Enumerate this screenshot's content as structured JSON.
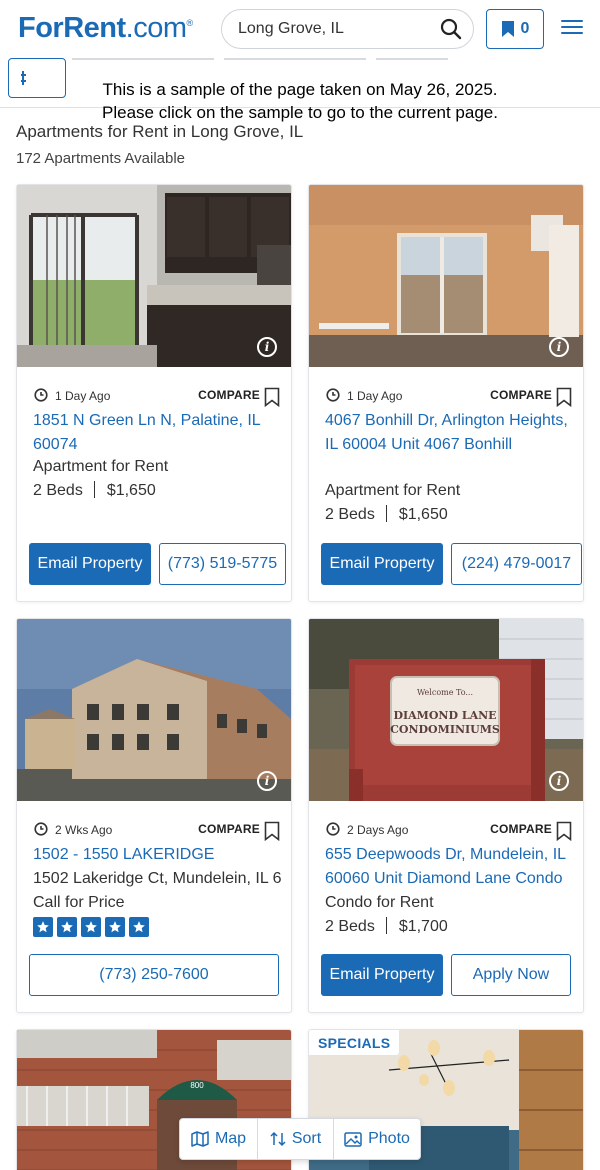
{
  "header": {
    "logo_main": "ForRent",
    "logo_dotcom": ".com",
    "logo_mark": "®",
    "search_value": "Long Grove, IL",
    "saved_count": "0"
  },
  "notice": {
    "line1": "This is a sample of the page taken on May 26, 2025.",
    "line2": "Please click on the sample to go to the current page."
  },
  "results": {
    "title": "Apartments for Rent in Long Grove, IL",
    "count_text": "172 Apartments Available"
  },
  "compare_label": "COMPARE",
  "listings": [
    {
      "posted": "1 Day Ago",
      "address": "1851 N Green Ln N, Palatine, IL 60074",
      "type": "Apartment for Rent",
      "beds": "2 Beds",
      "price": "$1,650",
      "email_label": "Email Property",
      "phone": "(773) 519-5775"
    },
    {
      "posted": "1 Day Ago",
      "address": "4067 Bonhill Dr, Arlington Heights, IL 60004 Unit 4067 Bonhill",
      "type": "Apartment for Rent",
      "beds": "2 Beds",
      "price": "$1,650",
      "email_label": "Email Property",
      "phone": "(224) 479-0017"
    },
    {
      "posted": "2 Wks Ago",
      "address": "1502 - 1550 LAKERIDGE",
      "street": "1502 Lakeridge Ct, Mundelein, IL 60060",
      "price_text": "Call for Price",
      "rating": 5,
      "phone": "(773) 250-7600"
    },
    {
      "posted": "2 Days Ago",
      "address": "655 Deepwoods Dr, Mundelein, IL 60060 Unit Diamond Lane Condo",
      "type": "Condo for Rent",
      "beds": "2 Beds",
      "price": "$1,700",
      "email_label": "Email Property",
      "apply_label": "Apply Now",
      "sign_line1": "Welcome To...",
      "sign_line2": "DIAMOND LANE",
      "sign_line3": "CONDOMINIUMS"
    },
    {
      "sign_text": "800"
    },
    {
      "badge": "SPECIALS"
    }
  ],
  "bottom_bar": {
    "map_label": "Map",
    "sort_label": "Sort",
    "photo_label": "Photo"
  },
  "colors": {
    "brand_blue": "#1b6ab5"
  }
}
